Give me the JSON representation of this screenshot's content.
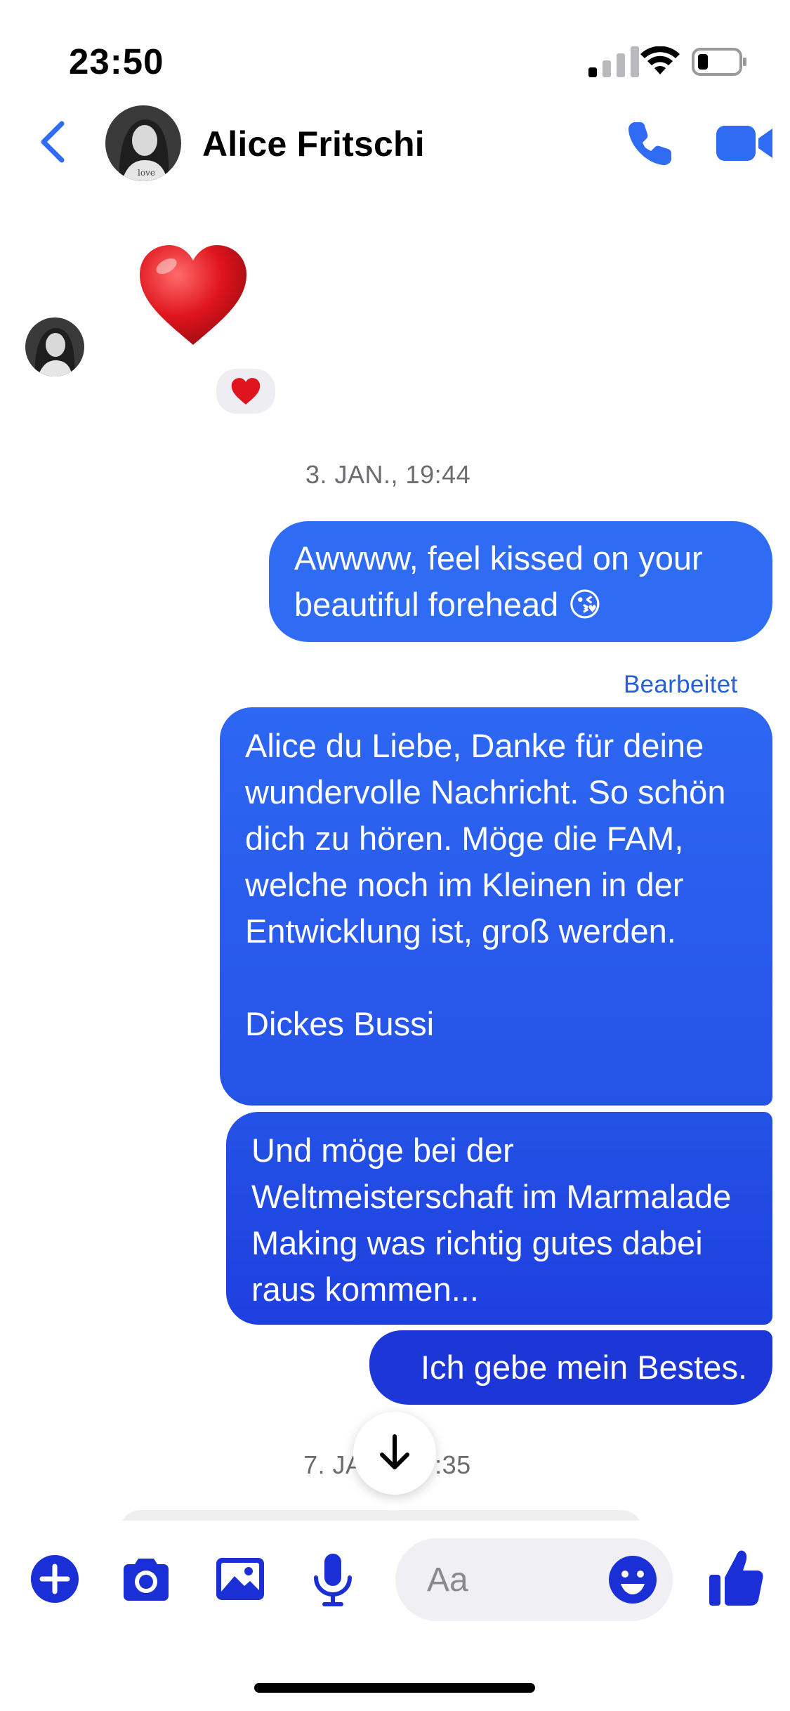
{
  "status_bar": {
    "time": "23:50"
  },
  "header": {
    "contact_name": "Alice Fritschi"
  },
  "messages": {
    "timestamp_1": "3. JAN., 19:44",
    "bubble_1": "Awwww, feel kissed on your beautiful forehead 😘",
    "edited_label": "Bearbeitet",
    "bubble_2": "Alice du Liebe, Danke für deine wundervolle Nachricht. So schön dich zu hören. Möge die FAM, welche noch im Kleinen in der Entwicklung ist, groß werden.\n\nDickes Bussi",
    "bubble_3": "Und möge bei der Weltmeisterschaft im Marmalade Making was richtig gutes dabei raus kommen...",
    "bubble_4": "Ich gebe mein Bestes.",
    "timestamp_2": "7. JA        9:35"
  },
  "composer": {
    "placeholder": "Aa"
  },
  "icons": {
    "back": "chevron-left-icon",
    "call": "phone-icon",
    "video": "video-camera-icon",
    "plus": "plus-circle-icon",
    "camera": "camera-icon",
    "gallery": "image-icon",
    "mic": "microphone-icon",
    "emoji": "smiley-icon",
    "like": "thumbs-up-icon",
    "scroll": "arrow-down-icon",
    "heart": "red-heart-icon"
  },
  "colors": {
    "accent": "#2f6cf3",
    "bubble_dark": "#1d36d8",
    "composer_blue": "#1a2fd6",
    "header_blue": "#2f6cf3"
  }
}
